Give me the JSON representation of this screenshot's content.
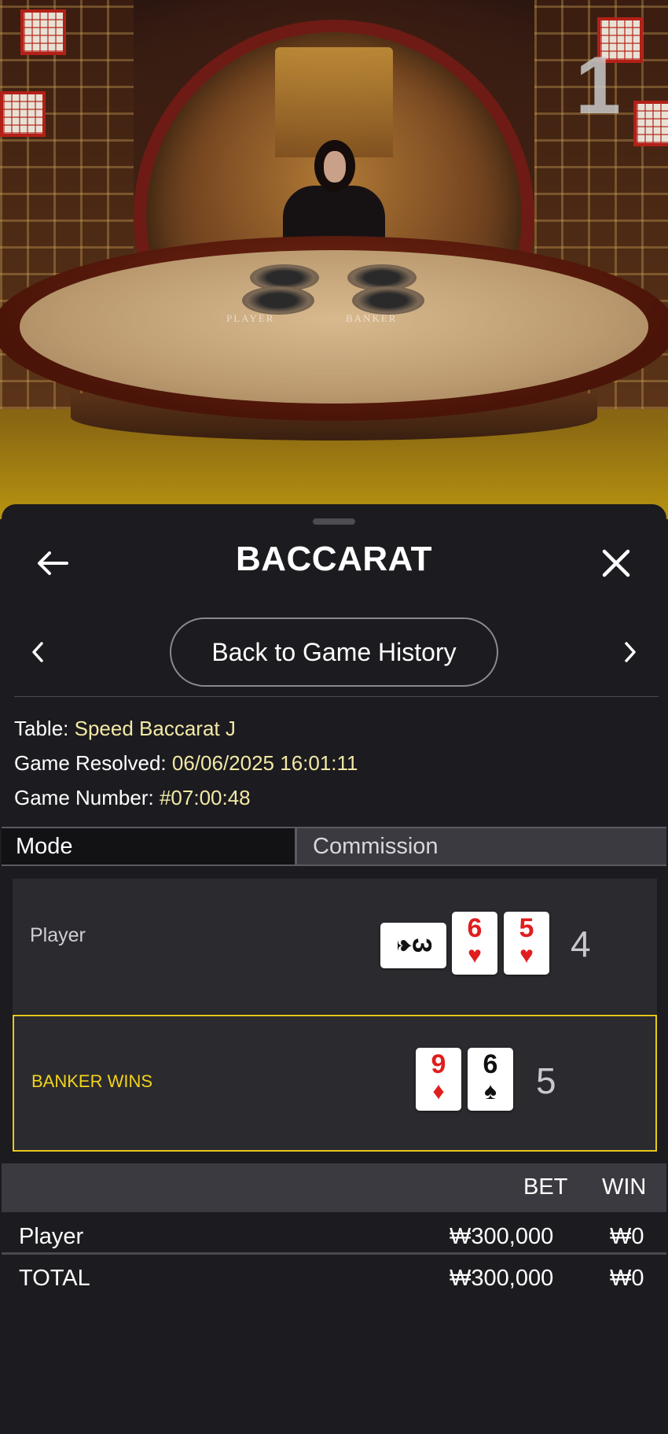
{
  "video": {
    "table_number": "1",
    "felt_labels": {
      "player": "PLAYER",
      "banker": "BANKER"
    }
  },
  "sheet": {
    "title": "BACCARAT",
    "back_icon": "arrow-left-icon",
    "close_icon": "close-icon",
    "prev_icon": "chevron-left-icon",
    "next_icon": "chevron-right-icon",
    "history_button_label": "Back to Game History"
  },
  "info": {
    "table_label": "Table:",
    "table_value": "Speed Baccarat J",
    "resolved_label": "Game Resolved:",
    "resolved_value": "06/06/2025 16:01:11",
    "number_label": "Game Number:",
    "number_value": "#07:00:48"
  },
  "tabs": {
    "mode": "Mode",
    "commission": "Commission"
  },
  "hands": {
    "player": {
      "label": "Player",
      "score": "4",
      "cards": [
        {
          "rank": "3",
          "suit": "♠",
          "color": "black",
          "rotated": true
        },
        {
          "rank": "6",
          "suit": "♥",
          "color": "red",
          "rotated": false
        },
        {
          "rank": "5",
          "suit": "♥",
          "color": "red",
          "rotated": false
        }
      ]
    },
    "banker": {
      "label": "BANKER WINS",
      "score": "5",
      "cards": [
        {
          "rank": "9",
          "suit": "♦",
          "color": "red",
          "rotated": false
        },
        {
          "rank": "6",
          "suit": "♠",
          "color": "black",
          "rotated": false
        }
      ]
    }
  },
  "bets": {
    "header": {
      "bet": "BET",
      "win": "WIN"
    },
    "rows": [
      {
        "name": "Player",
        "bet": "₩300,000",
        "win": "₩0"
      }
    ],
    "total": {
      "name": "TOTAL",
      "bet": "₩300,000",
      "win": "₩0"
    }
  },
  "colors": {
    "accent_value": "#f3e9a6",
    "winner_border": "#e6c81d",
    "card_red": "#e01e1e"
  }
}
